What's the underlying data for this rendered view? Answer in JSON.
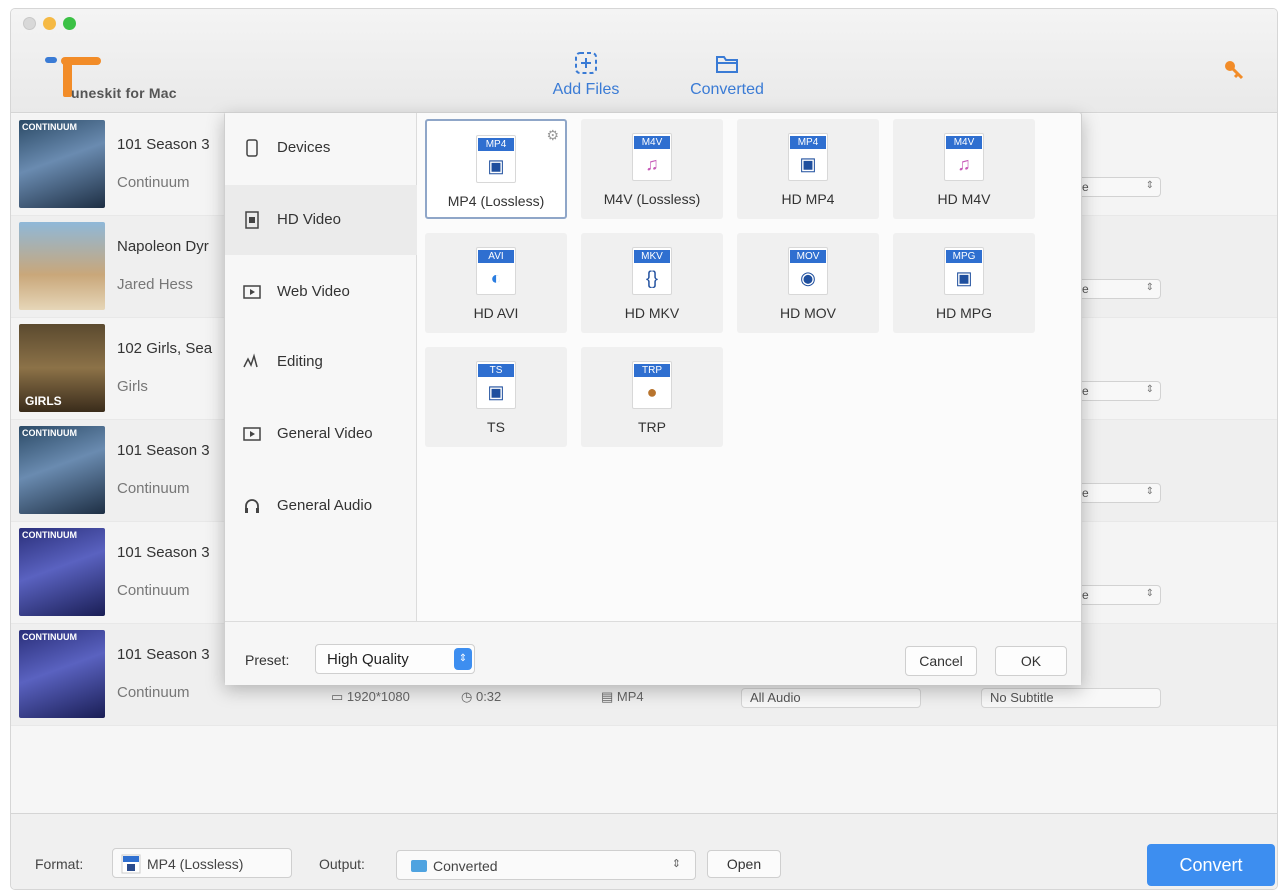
{
  "app": {
    "name": "uneskit for Mac"
  },
  "toolbar": {
    "add_files": "Add Files",
    "converted": "Converted"
  },
  "rows": [
    {
      "title": "101 Season 3",
      "subtitle": "Continuum",
      "tail": "e",
      "thumb": "CONTINUUM"
    },
    {
      "title": "Napoleon Dyr",
      "subtitle": "Jared Hess",
      "tail": "e",
      "thumb": ""
    },
    {
      "title": "102 Girls, Sea",
      "subtitle": "Girls",
      "tail": "e",
      "thumb": "GIRLS"
    },
    {
      "title": "101 Season 3",
      "subtitle": "Continuum",
      "tail": "e",
      "thumb": "CONTINUUM"
    },
    {
      "title": "101 Season 3",
      "subtitle": "Continuum",
      "tail": "e",
      "thumb": "CONTINUUM"
    },
    {
      "title": "101 Season 3",
      "subtitle": "Continuum",
      "tail": "",
      "thumb": "CONTINUUM"
    }
  ],
  "last_row_meta": {
    "resolution": "1920*1080",
    "duration": "0:32",
    "format": "MP4",
    "audio": "All Audio",
    "subtitle": "No Subtitle"
  },
  "dialog": {
    "categories": [
      {
        "label": "Devices",
        "icon": "phone-icon"
      },
      {
        "label": "HD Video",
        "icon": "hd-video-icon"
      },
      {
        "label": "Web Video",
        "icon": "web-video-icon"
      },
      {
        "label": "Editing",
        "icon": "editing-icon"
      },
      {
        "label": "General Video",
        "icon": "general-video-icon"
      },
      {
        "label": "General Audio",
        "icon": "headphones-icon"
      }
    ],
    "active_category": "HD Video",
    "formats": [
      {
        "tag": "MP4",
        "label": "MP4 (Lossless)"
      },
      {
        "tag": "M4V",
        "label": "M4V (Lossless)"
      },
      {
        "tag": "MP4",
        "label": "HD MP4"
      },
      {
        "tag": "M4V",
        "label": "HD M4V"
      },
      {
        "tag": "AVI",
        "label": "HD AVI"
      },
      {
        "tag": "MKV",
        "label": "HD MKV"
      },
      {
        "tag": "MOV",
        "label": "HD MOV"
      },
      {
        "tag": "MPG",
        "label": "HD MPG"
      },
      {
        "tag": "TS",
        "label": "TS"
      },
      {
        "tag": "TRP",
        "label": "TRP"
      }
    ],
    "selected_format": "MP4 (Lossless)",
    "preset_label": "Preset:",
    "preset_value": "High Quality",
    "cancel": "Cancel",
    "ok": "OK"
  },
  "bottom": {
    "format_label": "Format:",
    "format_value": "MP4 (Lossless)",
    "output_label": "Output:",
    "output_value": "Converted",
    "open": "Open",
    "convert": "Convert"
  },
  "colors": {
    "accent": "#3d8ef0",
    "tag_blue": "#2f6fd0",
    "logo_orange": "#f28c28"
  }
}
